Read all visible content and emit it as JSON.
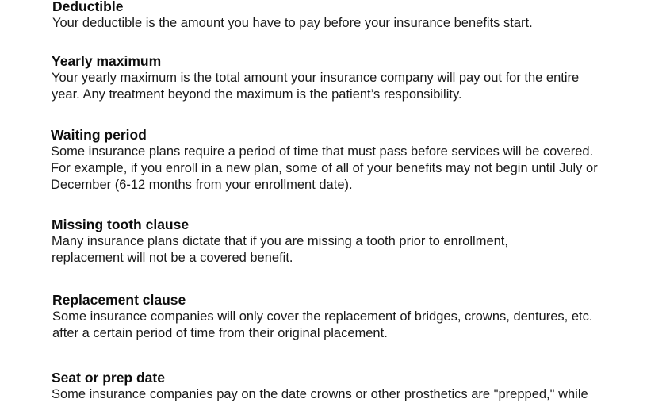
{
  "sections": [
    {
      "title": "Deductible",
      "lines": [
        "Your deductible is the amount you have to pay before your insurance benefits start."
      ]
    },
    {
      "title": "Yearly maximum",
      "lines": [
        "Your yearly maximum is the total amount your insurance company will pay out for the entire",
        "year. Any treatment beyond the maximum is the patient’s responsibility."
      ]
    },
    {
      "title": "Waiting period",
      "lines": [
        "Some insurance plans require a period of time that must pass before services will be covered.",
        "For example, if you enroll in a new plan, some of all of your benefits may not begin until July or",
        "December (6-12 months from your enrollment date)."
      ]
    },
    {
      "title": "Missing tooth clause",
      "lines": [
        "Many insurance plans dictate that if you are missing a tooth prior to enrollment,",
        "replacement will not be a covered benefit."
      ]
    },
    {
      "title": "Replacement clause",
      "lines": [
        "Some insurance companies will only cover the replacement of bridges, crowns, dentures, etc.",
        "after a certain period of time from their original placement."
      ]
    },
    {
      "title": "Seat or prep date",
      "lines": [
        "Some insurance companies pay on the date crowns or other prosthetics are \"prepped,\" while"
      ]
    }
  ]
}
